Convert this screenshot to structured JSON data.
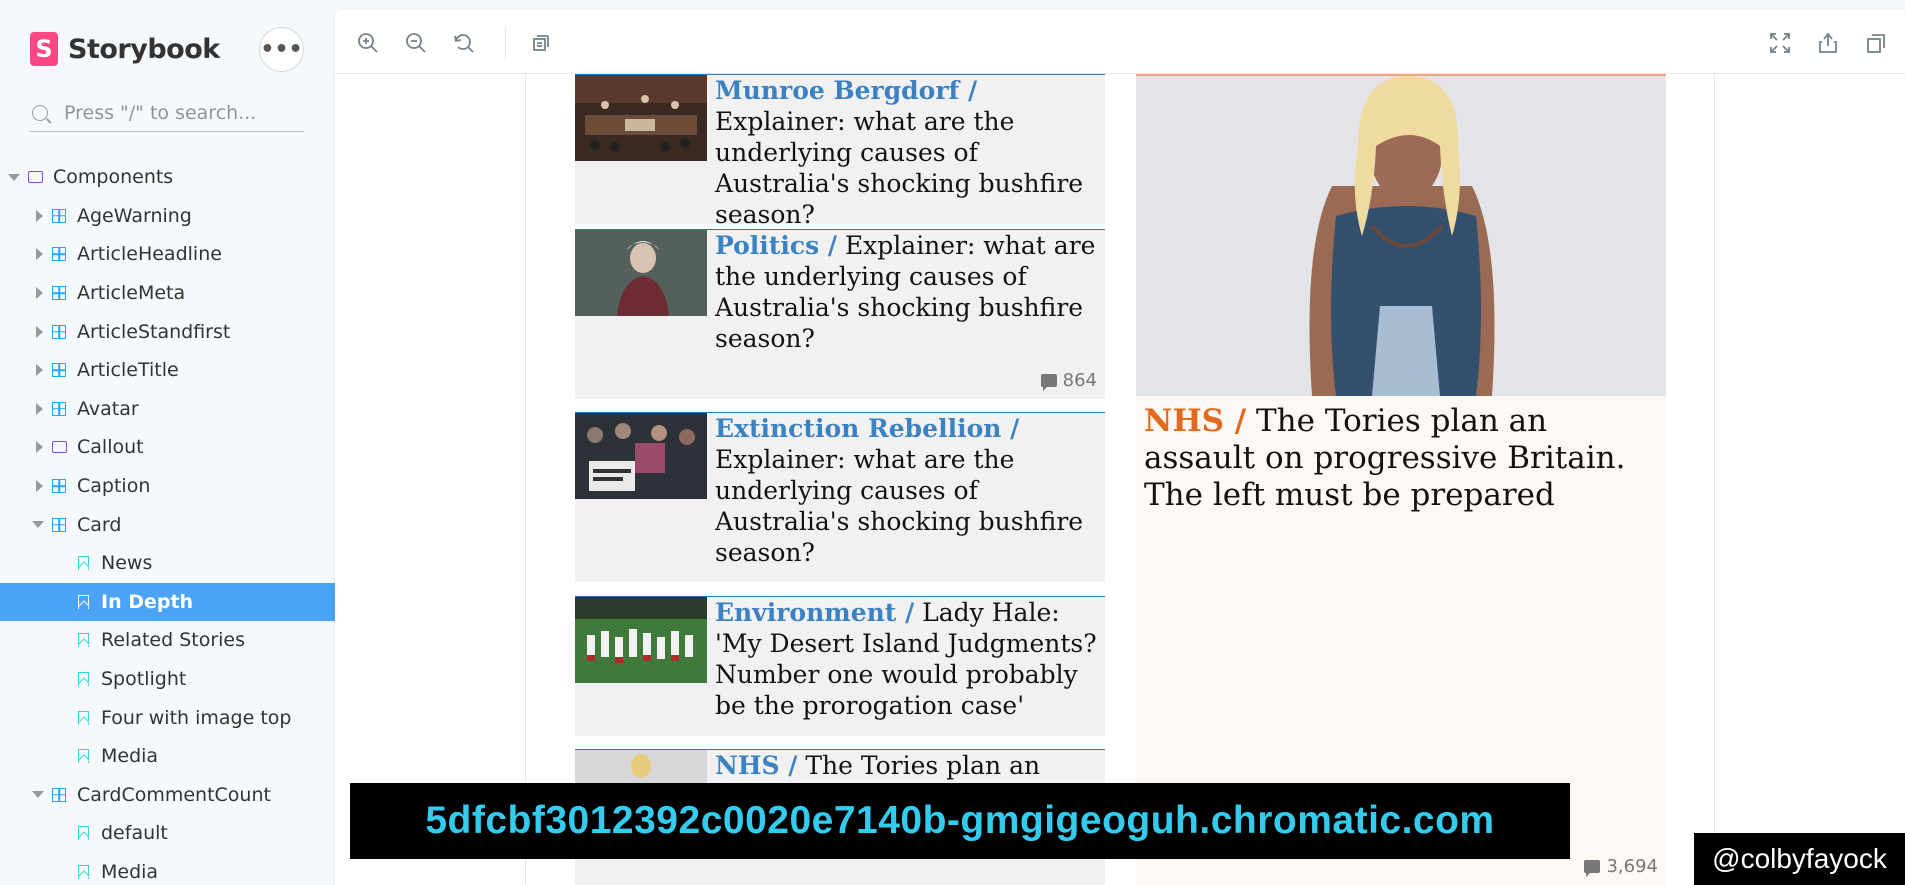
{
  "app": {
    "brand_initial": "S",
    "brand_title": "Storybook",
    "more_label": "•••"
  },
  "search": {
    "placeholder": "Press \"/\" to search..."
  },
  "tree": [
    {
      "label": "Components",
      "kind": "folder",
      "depth": 0,
      "expanded": true
    },
    {
      "label": "AgeWarning",
      "kind": "component",
      "depth": 1,
      "expanded": false
    },
    {
      "label": "ArticleHeadline",
      "kind": "component",
      "depth": 1,
      "expanded": false
    },
    {
      "label": "ArticleMeta",
      "kind": "component",
      "depth": 1,
      "expanded": false
    },
    {
      "label": "ArticleStandfirst",
      "kind": "component",
      "depth": 1,
      "expanded": false
    },
    {
      "label": "ArticleTitle",
      "kind": "component",
      "depth": 1,
      "expanded": false
    },
    {
      "label": "Avatar",
      "kind": "component",
      "depth": 1,
      "expanded": false
    },
    {
      "label": "Callout",
      "kind": "folder",
      "depth": 1,
      "expanded": false
    },
    {
      "label": "Caption",
      "kind": "component",
      "depth": 1,
      "expanded": false
    },
    {
      "label": "Card",
      "kind": "component",
      "depth": 1,
      "expanded": true
    },
    {
      "label": "News",
      "kind": "story",
      "depth": 2
    },
    {
      "label": "In Depth",
      "kind": "story",
      "depth": 2,
      "selected": true
    },
    {
      "label": "Related Stories",
      "kind": "story",
      "depth": 2
    },
    {
      "label": "Spotlight",
      "kind": "story",
      "depth": 2
    },
    {
      "label": "Four with image top",
      "kind": "story",
      "depth": 2
    },
    {
      "label": "Media",
      "kind": "story",
      "depth": 2
    },
    {
      "label": "CardCommentCount",
      "kind": "component",
      "depth": 1,
      "expanded": true
    },
    {
      "label": "default",
      "kind": "story",
      "depth": 2
    },
    {
      "label": "Media",
      "kind": "story",
      "depth": 2
    }
  ],
  "toolbar": {
    "zoom_in": "zoom-in-icon",
    "zoom_out": "zoom-out-icon",
    "zoom_reset": "reset-zoom-icon",
    "background": "background-icon",
    "fullscreen": "fullscreen-icon",
    "share": "share-icon",
    "copy": "copy-icon"
  },
  "cards": [
    {
      "kicker": "Munroe Bergdorf /",
      "headline": "Explainer: what are the underlying causes of Australia's shocking bushfire season?",
      "comments": ""
    },
    {
      "kicker": "Politics /",
      "headline": "Explainer: what are the underlying causes of Australia's shocking bushfire season?",
      "comments": "864"
    },
    {
      "kicker": "Extinction Rebellion /",
      "headline": "Explainer: what are the underlying causes of Australia's shocking bushfire season?",
      "comments": ""
    },
    {
      "kicker": "Environment /",
      "headline": "Lady Hale: 'My Desert Island Judgments? Number one would probably be the prorogation case'",
      "comments": ""
    },
    {
      "kicker": "NHS /",
      "headline": "The Tories plan an",
      "comments": ""
    }
  ],
  "feature": {
    "kicker": "NHS /",
    "headline": "The Tories plan an assault on progressive Britain. The left must be prepared",
    "comments": "3,694"
  },
  "overlay": {
    "url": "5dfcbf3012392c0020e7140b-gmgigeoguh.chromatic.com",
    "handle": "@colbyfayock"
  },
  "colors": {
    "accent": "#1ea7fd",
    "selected_bg": "#4aa3f5",
    "kicker_blue": "#3c82c2",
    "kicker_orange": "#e06a1d",
    "brand_pink": "#ff4785"
  }
}
